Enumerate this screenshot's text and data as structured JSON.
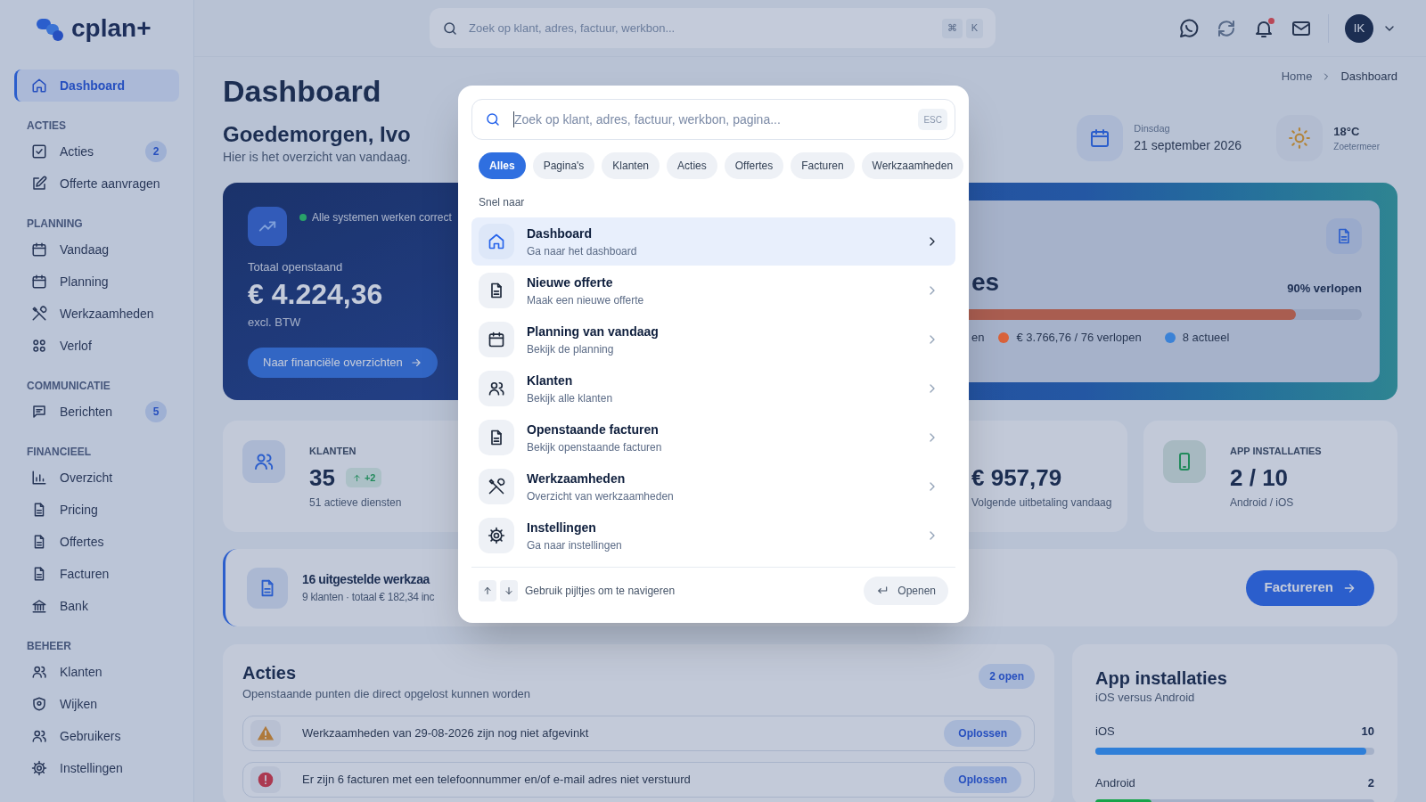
{
  "topbar": {
    "search": {
      "placeholder": "Zoek op klant, adres, factuur, werkbon...",
      "keys": [
        "⌘",
        "K"
      ]
    },
    "notifications_unread": true,
    "avatar": "IK"
  },
  "sidebar": {
    "logo": "cplan+",
    "items": [
      {
        "label": "Dashboard",
        "selected": true
      }
    ],
    "sections": [
      {
        "title": "ACTIES",
        "items": [
          {
            "label": "Acties",
            "badge": "2",
            "selected": false
          },
          {
            "label": "Offerte aanvragen",
            "selected": false
          }
        ]
      },
      {
        "title": "PLANNING",
        "items": [
          {
            "label": "Vandaag",
            "selected": false
          },
          {
            "label": "Planning",
            "selected": false
          },
          {
            "label": "Werkzaamheden",
            "selected": false
          },
          {
            "label": "Verlof",
            "selected": false
          }
        ]
      },
      {
        "title": "COMMUNICATIE",
        "items": [
          {
            "label": "Berichten",
            "badge": "5",
            "selected": false
          }
        ]
      },
      {
        "title": "FINANCIEEL",
        "items": [
          {
            "label": "Overzicht",
            "selected": false
          },
          {
            "label": "Pricing",
            "selected": false
          },
          {
            "label": "Offertes",
            "selected": false
          },
          {
            "label": "Facturen",
            "selected": false
          },
          {
            "label": "Bank",
            "selected": false
          }
        ]
      },
      {
        "title": "BEHEER",
        "items": [
          {
            "label": "Klanten",
            "selected": false
          },
          {
            "label": "Wijken",
            "selected": false
          },
          {
            "label": "Gebruikers",
            "selected": false
          },
          {
            "label": "Instellingen",
            "selected": false
          }
        ]
      }
    ]
  },
  "breadcrumb": [
    "Home",
    "Dashboard"
  ],
  "header": {
    "title": "Dashboard",
    "greeting": "Goedemorgen, Ivo",
    "subtitle": "Hier is het overzicht van vandaag."
  },
  "date": {
    "weekday": "Dinsdag",
    "date": "21 september 2026"
  },
  "weather": {
    "temperature": "18°C",
    "place": "Zoetermeer"
  },
  "finance_card": {
    "status": "Alle systemen werken correct",
    "label": "Totaal openstaand",
    "amount": "€ 4.224,36",
    "note": "excl. BTW",
    "button": "Naar financiële overzichten"
  },
  "subscription_card": {
    "title": "es",
    "percentage": "90% verlopen",
    "level": 0.88,
    "legend_cut": "en",
    "legend": [
      {
        "label": "€ 3.766,76 / 76 verlopen",
        "color": "#d9623a"
      },
      {
        "label": "8 actueel",
        "color": "#3b82d6"
      }
    ]
  },
  "stats": [
    {
      "kind": "klanten",
      "label": "KLANTEN",
      "value": "35",
      "delta": "+2",
      "sub": "51 actieve diensten"
    },
    {
      "kind": "payout",
      "value": "€ 957,79",
      "sub": "Volgende uitbetaling vandaag"
    },
    {
      "kind": "apps",
      "label": "APP INSTALLATIES",
      "value": "2 / 10",
      "sub": "Android / iOS"
    }
  ],
  "banner": {
    "title": "16 uitgestelde werkzaa",
    "subtitle": "9 klanten · totaal € 182,34 inc",
    "button": "Factureren"
  },
  "actions": {
    "title": "Acties",
    "subtitle": "Openstaande punten die direct opgelost kunnen worden",
    "badge": "2 open",
    "items": [
      {
        "kind": "warning",
        "text": "Werkzaamheden van 29-08-2026 zijn nog niet afgevinkt",
        "button": "Oplossen"
      },
      {
        "kind": "error",
        "text": "Er zijn 6 facturen met een telefoonnummer en/of e-mail adres niet verstuurd",
        "button": "Oplossen"
      }
    ]
  },
  "app_installs": {
    "title": "App installaties",
    "subtitle": "iOS versus Android",
    "rows": [
      {
        "label": "iOS",
        "value": "10",
        "level": 0.97,
        "color": "#2f7fd8"
      },
      {
        "label": "Android",
        "value": "2",
        "level": 0.2,
        "color": "#16a34a"
      }
    ]
  },
  "command_palette": {
    "placeholder": "Zoek op klant, adres, factuur, werkbon, pagina...",
    "esc": "ESC",
    "filters": [
      {
        "label": "Alles",
        "selected": true
      },
      {
        "label": "Pagina's",
        "selected": false
      },
      {
        "label": "Klanten",
        "selected": false
      },
      {
        "label": "Acties",
        "selected": false
      },
      {
        "label": "Offertes",
        "selected": false
      },
      {
        "label": "Facturen",
        "selected": false
      },
      {
        "label": "Werkzaamheden",
        "selected": false
      }
    ],
    "section": "Snel naar",
    "results": [
      {
        "title": "Dashboard",
        "subtitle": "Ga naar het dashboard",
        "selected": true
      },
      {
        "title": "Nieuwe offerte",
        "subtitle": "Maak een nieuwe offerte",
        "selected": false
      },
      {
        "title": "Planning van vandaag",
        "subtitle": "Bekijk de planning",
        "selected": false
      },
      {
        "title": "Klanten",
        "subtitle": "Bekijk alle klanten",
        "selected": false
      },
      {
        "title": "Openstaande facturen",
        "subtitle": "Bekijk openstaande facturen",
        "selected": false
      },
      {
        "title": "Werkzaamheden",
        "subtitle": "Overzicht van werkzaamheden",
        "selected": false
      },
      {
        "title": "Instellingen",
        "subtitle": "Ga naar instellingen",
        "selected": false
      }
    ],
    "hint": "Gebruik pijltjes om te navigeren",
    "open_button": "Openen"
  }
}
